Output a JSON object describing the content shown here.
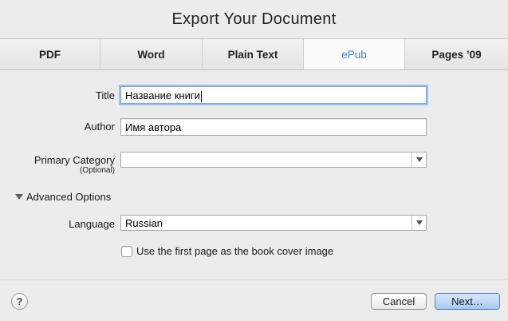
{
  "window": {
    "title": "Export Your Document"
  },
  "tabs": [
    {
      "label": "PDF",
      "active": false
    },
    {
      "label": "Word",
      "active": false
    },
    {
      "label": "Plain Text",
      "active": false
    },
    {
      "label": "ePub",
      "active": true
    },
    {
      "label": "Pages ’09",
      "active": false
    }
  ],
  "form": {
    "title_label": "Title",
    "title_value": "Название книги",
    "author_label": "Author",
    "author_value": "Имя автора",
    "category_label": "Primary Category",
    "category_sublabel": "(Optional)",
    "category_value": "",
    "advanced_label": "Advanced Options",
    "language_label": "Language",
    "language_value": "Russian",
    "cover_checkbox_label": "Use the first page as the book cover image",
    "cover_checked": false
  },
  "footer": {
    "help_label": "?",
    "cancel_label": "Cancel",
    "next_label": "Next…"
  },
  "colors": {
    "active_tab_text": "#3b7fd6",
    "focus_ring": "#9cc2f0",
    "primary_button": "#a7c8f1"
  },
  "icons": {
    "dropdown": "chevron-down-icon",
    "disclosure": "disclosure-triangle-icon",
    "help": "help-icon"
  }
}
